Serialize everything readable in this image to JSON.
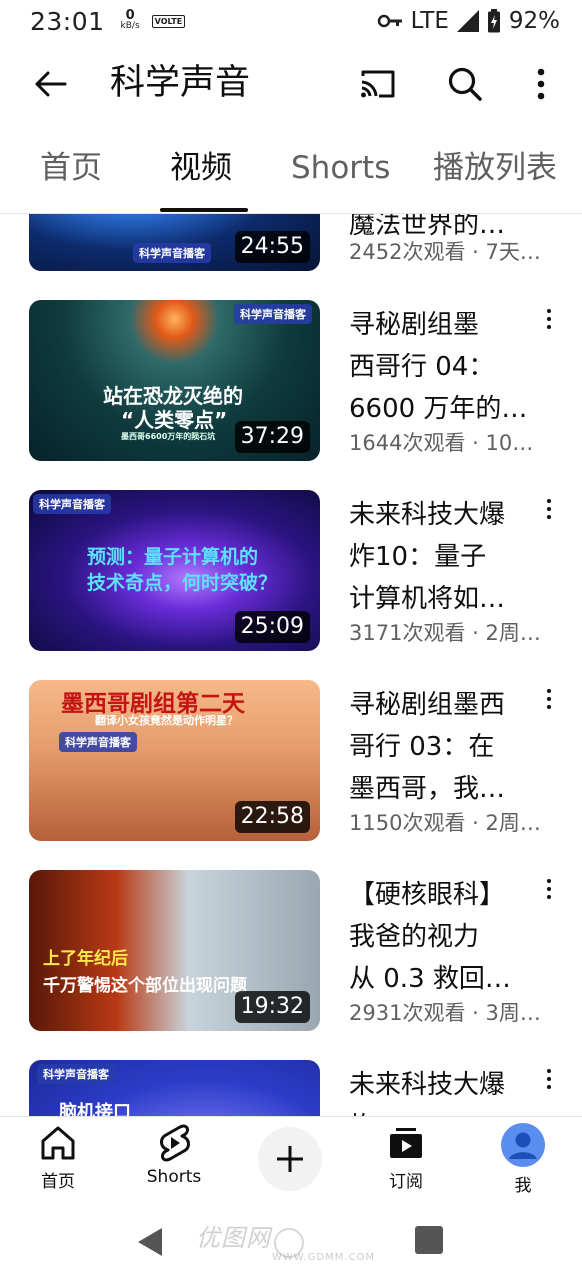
{
  "status_bar": {
    "time": "23:01",
    "net_speed_value": "0",
    "net_speed_unit": "kB/s",
    "volte": "VOLTE",
    "network": "LTE",
    "battery": "92%"
  },
  "header": {
    "title": "科学声音",
    "back_icon": "arrow-left-icon",
    "cast_icon": "cast-icon",
    "search_icon": "search-icon",
    "more_icon": "more-vert-icon"
  },
  "tabs": [
    {
      "label": "首页"
    },
    {
      "label": "视频",
      "active": true
    },
    {
      "label": "Shorts"
    },
    {
      "label": "播放列表"
    }
  ],
  "videos": [
    {
      "title_lines": [
        "魔法世界的…"
      ],
      "meta": "2452次观看 · 7天…",
      "duration": "24:55",
      "thumb_badge": "科学声音播客"
    },
    {
      "title_lines": [
        "寻秘剧组墨",
        "西哥行 04：",
        "6600 万年的…"
      ],
      "meta": "1644次观看 · 10…",
      "duration": "37:29",
      "thumb_badge": "科学声音播客",
      "thumb_text": [
        "站在恐龙灭绝的",
        "“人类零点”",
        "墨西哥6600万年的陨石坑"
      ]
    },
    {
      "title_lines": [
        "未来科技大爆",
        "炸10：量子",
        "计算机将如…"
      ],
      "meta": "3171次观看 · 2周…",
      "duration": "25:09",
      "thumb_badge": "科学声音播客",
      "thumb_text": [
        "预测：量子计算机的",
        "技术奇点，何时突破？"
      ]
    },
    {
      "title_lines": [
        "寻秘剧组墨西",
        "哥行 03：在",
        "墨西哥，我…"
      ],
      "meta": "1150次观看 · 2周…",
      "duration": "22:58",
      "thumb_badge": "科学声音播客",
      "thumb_text": [
        "墨西哥剧组第二天",
        "翻译小女孩竟然是动作明星？"
      ]
    },
    {
      "title_lines": [
        "【硬核眼科】",
        "我爸的视力",
        "从 0.3 救回…"
      ],
      "meta": "2931次观看 · 3周…",
      "duration": "19:32",
      "thumb_text": [
        "上了年纪后",
        "千万警惕这个部位出现问题"
      ]
    },
    {
      "title_lines": [
        "未来科技大爆",
        "炸…"
      ],
      "thumb_badge": "科学声音播客",
      "thumb_text": [
        "脑机接口"
      ]
    }
  ],
  "bottom_nav": {
    "home": "首页",
    "shorts": "Shorts",
    "create_icon": "plus-icon",
    "subscriptions": "订阅",
    "you": "我"
  },
  "system_nav": {
    "watermark": "优图网",
    "watermark_sub": "WWW.GDMM.COM"
  },
  "colors": {
    "text_primary": "#0f0f0f",
    "text_secondary": "#606060",
    "avatar": "#5b8cf0"
  }
}
